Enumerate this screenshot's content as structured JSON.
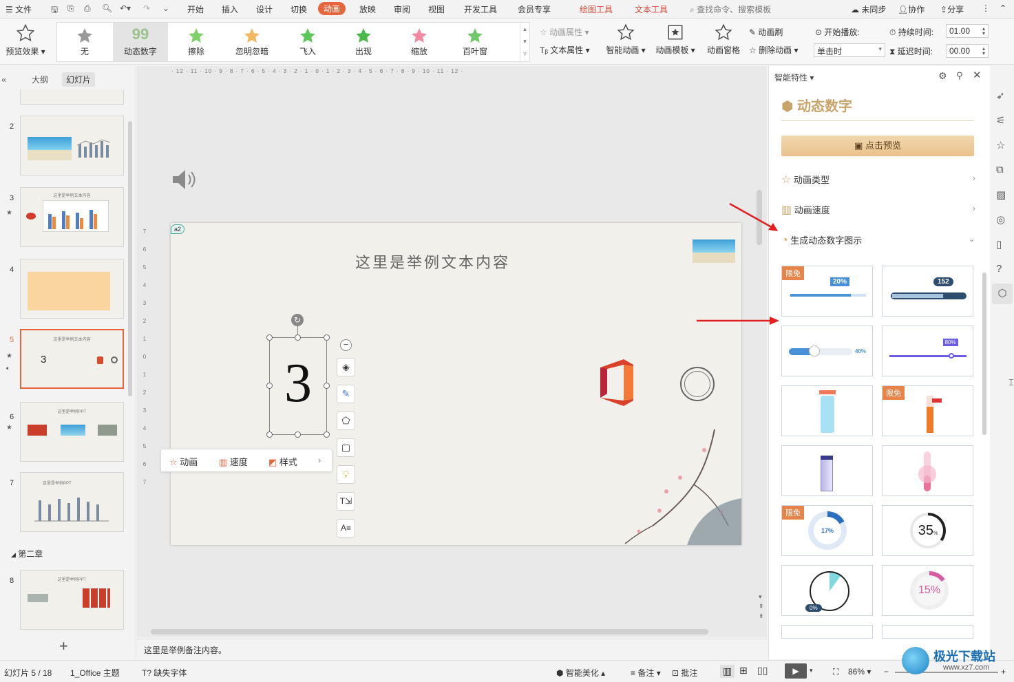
{
  "menubar": {
    "file": "文件",
    "items": [
      "开始",
      "插入",
      "设计",
      "切换",
      "动画",
      "放映",
      "审阅",
      "视图",
      "开发工具",
      "会员专享"
    ],
    "active": "动画",
    "context_tabs": [
      "绘图工具",
      "文本工具"
    ],
    "search_placeholder": "查找命令、搜索模板",
    "right": [
      "未同步",
      "协作",
      "分享"
    ]
  },
  "ribbon": {
    "preview": "预览效果",
    "gallery": [
      "无",
      "动态数字",
      "擦除",
      "忽明忽暗",
      "飞入",
      "出现",
      "缩放",
      "百叶窗"
    ],
    "gallery_selected": "动态数字",
    "anim_prop": "动画属性",
    "text_prop": "文本属性",
    "smart_anim": "智能动画",
    "anim_template": "动画模板",
    "anim_pane": "动画窗格",
    "anim_brush": "动画刷",
    "delete_anim": "删除动画",
    "start_play": "开始播放:",
    "start_value": "单击时",
    "duration_label": "持续时间:",
    "duration_value": "01.00",
    "delay_label": "延迟时间:",
    "delay_value": "00.00"
  },
  "leftpanel": {
    "tabs": [
      "大纲",
      "幻灯片"
    ],
    "active_tab": "幻灯片",
    "slides": [
      "2",
      "3",
      "4",
      "5",
      "6",
      "7",
      "8"
    ],
    "selected_slide": "5",
    "section": "第二章",
    "thumb_titles": {
      "3": "这里是举例文本内容",
      "5": "这里是举例文本内容",
      "6": "这里是举例PPT",
      "7": "这里是举例PPT",
      "8": "这里是举例PPT"
    },
    "thumb5_number": "3"
  },
  "slide": {
    "title": "这里是举例文本内容",
    "number": "3",
    "tag": "a2",
    "float_toolbar": [
      "动画",
      "速度",
      "样式"
    ]
  },
  "notes": "这里是举例备注内容。",
  "rightpanel": {
    "header": "智能特性",
    "title": "动态数字",
    "preview_button": "点击预览",
    "rows": [
      "动画类型",
      "动画速度",
      "生成动态数字图示"
    ],
    "badge": "限免",
    "cards": [
      {
        "badge": true,
        "value": "20%",
        "progress": 0.8
      },
      {
        "badge": false,
        "value": "152",
        "progress": 0.7
      },
      {
        "badge": false,
        "value": "40%",
        "progress": 0.4
      },
      {
        "badge": false,
        "value": "80%",
        "progress": 0.8
      },
      {
        "badge": false,
        "value": "",
        "progress": 0.6
      },
      {
        "badge": true,
        "value": "",
        "progress": 0.7
      },
      {
        "badge": false,
        "value": "",
        "progress": 0.5
      },
      {
        "badge": false,
        "value": "",
        "progress": 0.4
      },
      {
        "badge": true,
        "value": "17%",
        "progress": 0.17
      },
      {
        "badge": false,
        "value": "35",
        "progress": 0.35
      },
      {
        "badge": false,
        "value": "0%",
        "progress": 0.1
      },
      {
        "badge": false,
        "value": "15%",
        "progress": 0.15
      }
    ]
  },
  "status": {
    "slide_info": "幻灯片 5 / 18",
    "theme": "1_Office 主题",
    "missing_font": "缺失字体",
    "smart_beautify": "智能美化",
    "notes": "备注",
    "comments": "批注",
    "zoom": "86%"
  },
  "watermark": {
    "site": "极光下载站",
    "url": "www.xz7.com"
  },
  "colors": {
    "accent": "#e8643c",
    "red_arrow": "#e02020",
    "gold": "#c9a46a"
  }
}
